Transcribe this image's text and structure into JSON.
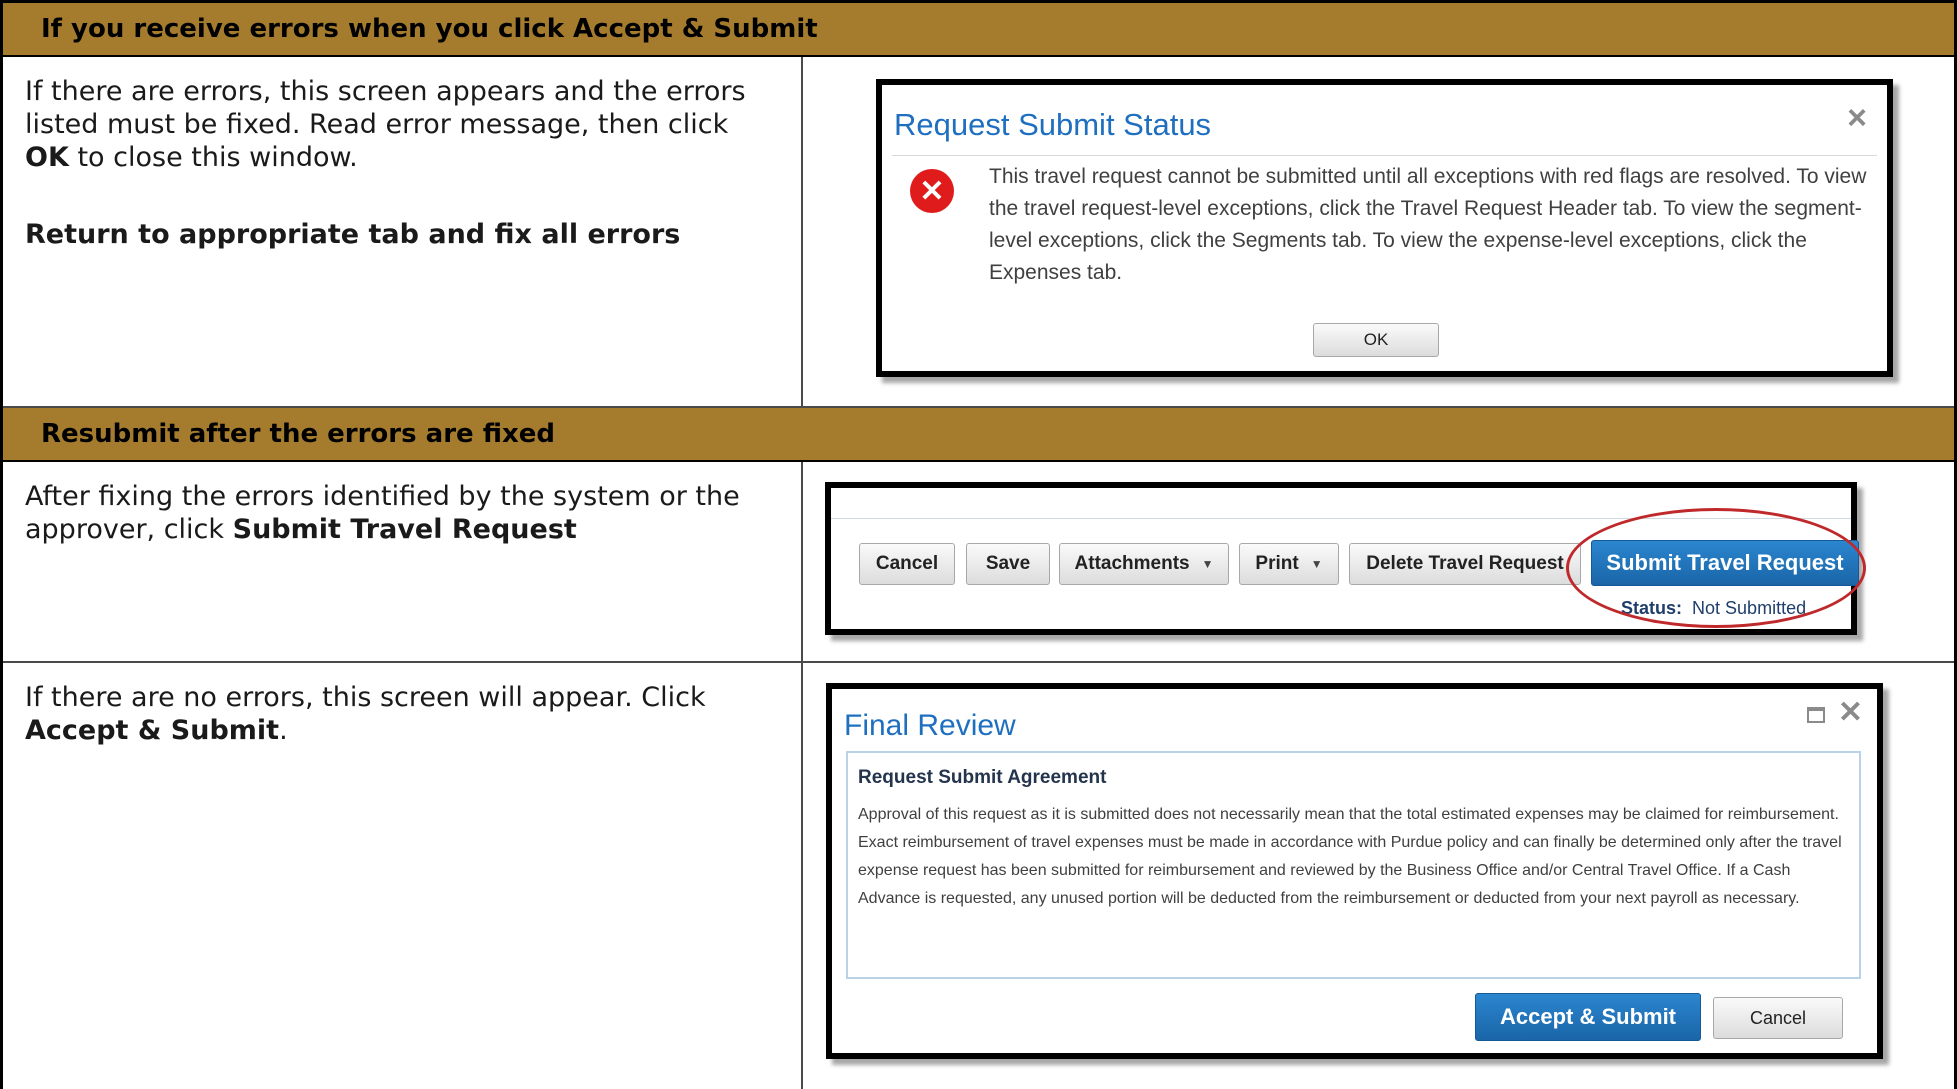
{
  "section1": {
    "header": "If you receive errors when you click Accept & Submit",
    "left": {
      "p1_a": "If there are errors, this screen appears and the errors listed must be fixed. Read error message, then click ",
      "p1_bold": "OK",
      "p1_b": " to close this window.",
      "p2_bold": "Return to appropriate tab and fix all errors"
    },
    "dialog": {
      "title": "Request Submit Status",
      "close": "×",
      "message": "This travel request cannot be submitted until all exceptions with red flags are resolved. To view the travel request-level exceptions, click the Travel Request Header tab. To view the segment-level exceptions, click the Segments tab. To view the expense-level exceptions, click the Expenses tab.",
      "ok_label": "OK",
      "error_icon": "error-x-circle-icon",
      "error_color": "#e01b1b"
    }
  },
  "section2": {
    "header": "Resubmit after the errors are fixed",
    "row1": {
      "text_a": "After fixing the errors identified by the system or the approver, click ",
      "text_bold": "Submit Travel Request",
      "toolbar": {
        "cancel": "Cancel",
        "save": "Save",
        "attachments": "Attachments",
        "print": "Print",
        "delete": "Delete Travel Request",
        "submit": "Submit Travel Request",
        "status_label": "Status:",
        "status_value": "Not Submitted"
      }
    },
    "row2": {
      "text_a": "If there are no errors, this screen will appear. Click ",
      "text_bold": "Accept & Submit",
      "text_end": ".",
      "dialog": {
        "title": "Final Review",
        "subtitle": "Request Submit Agreement",
        "body": "Approval of this request as it is submitted does not necessarily mean that the total estimated expenses may be claimed for reimbursement. Exact reimbursement of travel expenses must be made in accordance with Purdue policy and can finally be determined only after the travel expense request has been submitted for reimbursement and reviewed by the Business Office and/or Central Travel Office. If a Cash Advance is requested, any unused portion will be deducted from the reimbursement or deducted from your next payroll as necessary.",
        "accept": "Accept & Submit",
        "cancel": "Cancel"
      }
    }
  },
  "colors": {
    "header_bg": "#a57c2e",
    "accent_blue": "#1f6fc0",
    "highlight_circle": "#c0292c"
  }
}
